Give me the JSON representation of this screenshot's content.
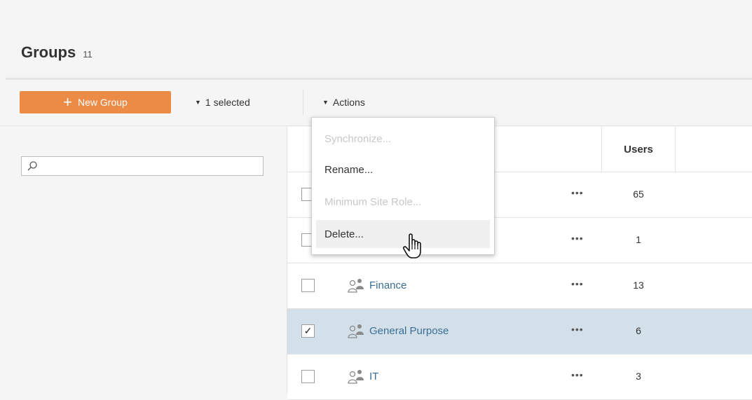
{
  "header": {
    "title": "Groups",
    "count": "11"
  },
  "toolbar": {
    "new_group_label": "New Group",
    "selected_label": "1 selected",
    "actions_label": "Actions"
  },
  "search": {
    "placeholder": ""
  },
  "table": {
    "columns": {
      "users": "Users"
    },
    "rows": [
      {
        "name": "",
        "users": "65",
        "checked": false
      },
      {
        "name": "",
        "users": "1",
        "checked": false
      },
      {
        "name": "Finance",
        "users": "13",
        "checked": false
      },
      {
        "name": "General Purpose",
        "users": "6",
        "checked": true
      },
      {
        "name": "IT",
        "users": "3",
        "checked": false
      }
    ],
    "more_label": "•••",
    "check_mark": "✓"
  },
  "actions_menu": {
    "items": [
      {
        "label": "Synchronize...",
        "enabled": false
      },
      {
        "label": "Rename...",
        "enabled": true
      },
      {
        "label": "Minimum Site Role...",
        "enabled": false
      },
      {
        "label": "Delete...",
        "enabled": true
      }
    ]
  },
  "colors": {
    "accent": "#ec8b46",
    "link": "#3a6f95",
    "selected_row": "#d3e0ea"
  }
}
